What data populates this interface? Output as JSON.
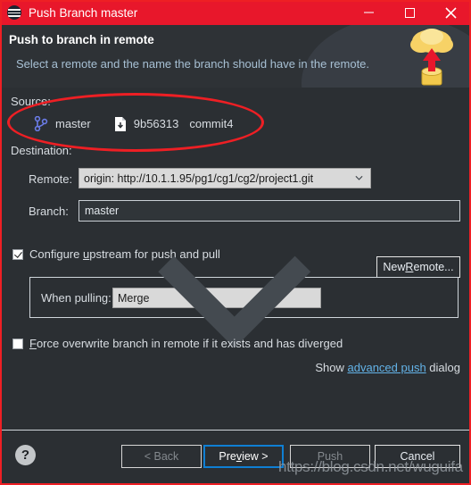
{
  "window": {
    "title": "Push Branch master",
    "icon": "eclipse-git-icon",
    "minimize_label": "–",
    "maximize_label": "□",
    "close_label": "✕",
    "titlebar_color": "#e8172b"
  },
  "header": {
    "title": "Push to branch in remote",
    "subtitle": "Select a remote and the name the branch should have in the remote.",
    "banner_icon": "cloud-upload-icon"
  },
  "source": {
    "label": "Source:",
    "branch_icon": "git-branch-icon",
    "branch": "master",
    "commit_icon": "commit-file-icon",
    "commit_sha": "9b56313",
    "commit_message": "commit4"
  },
  "destination": {
    "label": "Destination:",
    "remote_label": "Remote:",
    "remote_value": "origin: http://10.1.1.95/pg1/cg1/cg2/project1.git",
    "remote_dropdown_icon": "chevron-down-icon",
    "new_remote_button": {
      "prefix": "New ",
      "mnemonic": "R",
      "suffix": "emote..."
    },
    "branch_label": "Branch:",
    "branch_value": "master"
  },
  "options": {
    "upstream": {
      "checked": true,
      "prefix": "Configure ",
      "mnemonic": "u",
      "suffix": "pstream for push and pull"
    },
    "when_pulling": {
      "label": "When pulling:",
      "value": "Merge",
      "dropdown_icon": "chevron-down-icon"
    },
    "force": {
      "checked": false,
      "prefix": "",
      "mnemonic": "F",
      "suffix": "orce overwrite branch in remote if it exists and has diverged"
    },
    "advanced": {
      "before": "Show ",
      "link": "advanced push",
      "after": " dialog"
    }
  },
  "footer": {
    "help_icon": "?",
    "buttons": [
      {
        "label": "< Back",
        "state": "disabled"
      },
      {
        "label": "Preview >",
        "state": "focused"
      },
      {
        "label": "Push",
        "state": "disabled"
      },
      {
        "label": "Cancel",
        "state": "normal"
      }
    ],
    "preview_prefix": "Pre",
    "preview_mnemonic": "v",
    "preview_suffix": "iew >"
  },
  "annotations": {
    "watermark": "https://blog.csdn.net/wuguifa",
    "highlight_color": "#ee1f24"
  }
}
